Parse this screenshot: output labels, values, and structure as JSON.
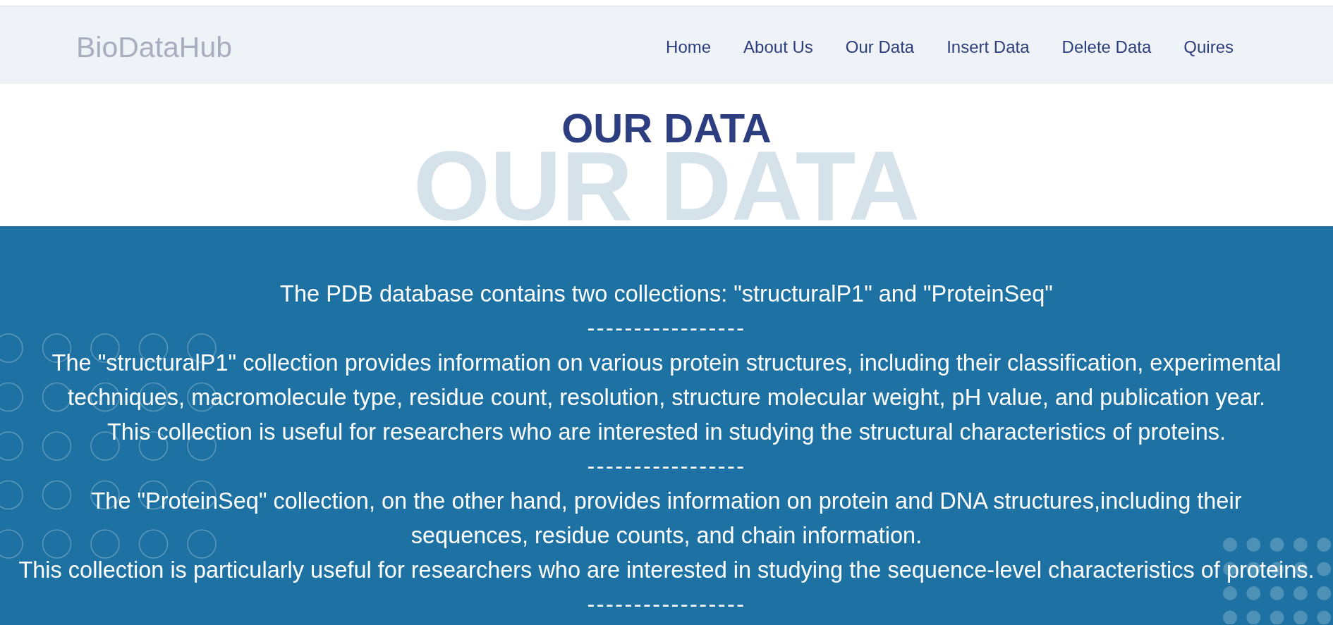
{
  "header": {
    "logo": "BioDataHub",
    "nav": [
      {
        "label": "Home"
      },
      {
        "label": "About Us"
      },
      {
        "label": "Our Data"
      },
      {
        "label": "Insert Data"
      },
      {
        "label": "Delete Data"
      },
      {
        "label": "Quires"
      }
    ]
  },
  "hero": {
    "title": "OUR DATA",
    "backdrop_text": "OUR DATA"
  },
  "content": {
    "blocks": [
      {
        "kind": "line",
        "text": "The PDB database contains two collections: \"structuralP1\" and \"ProteinSeq\""
      },
      {
        "kind": "divider",
        "text": "-----------------"
      },
      {
        "kind": "paragraph",
        "text": "The \"structuralP1\" collection provides information on various protein structures, including their classification, experimental techniques, macromolecule type, residue count, resolution, structure molecular weight, pH value, and publication year."
      },
      {
        "kind": "line",
        "text": "This collection is useful for researchers who are interested in studying the structural characteristics of proteins."
      },
      {
        "kind": "divider",
        "text": "-----------------"
      },
      {
        "kind": "paragraph",
        "text": "The \"ProteinSeq\" collection, on the other hand, provides information on protein and DNA structures,including their sequences, residue counts, and chain information."
      },
      {
        "kind": "line",
        "text": "This collection is particularly useful for researchers who are interested in studying the sequence-level characteristics of proteins."
      },
      {
        "kind": "divider",
        "text": "-----------------"
      }
    ]
  }
}
